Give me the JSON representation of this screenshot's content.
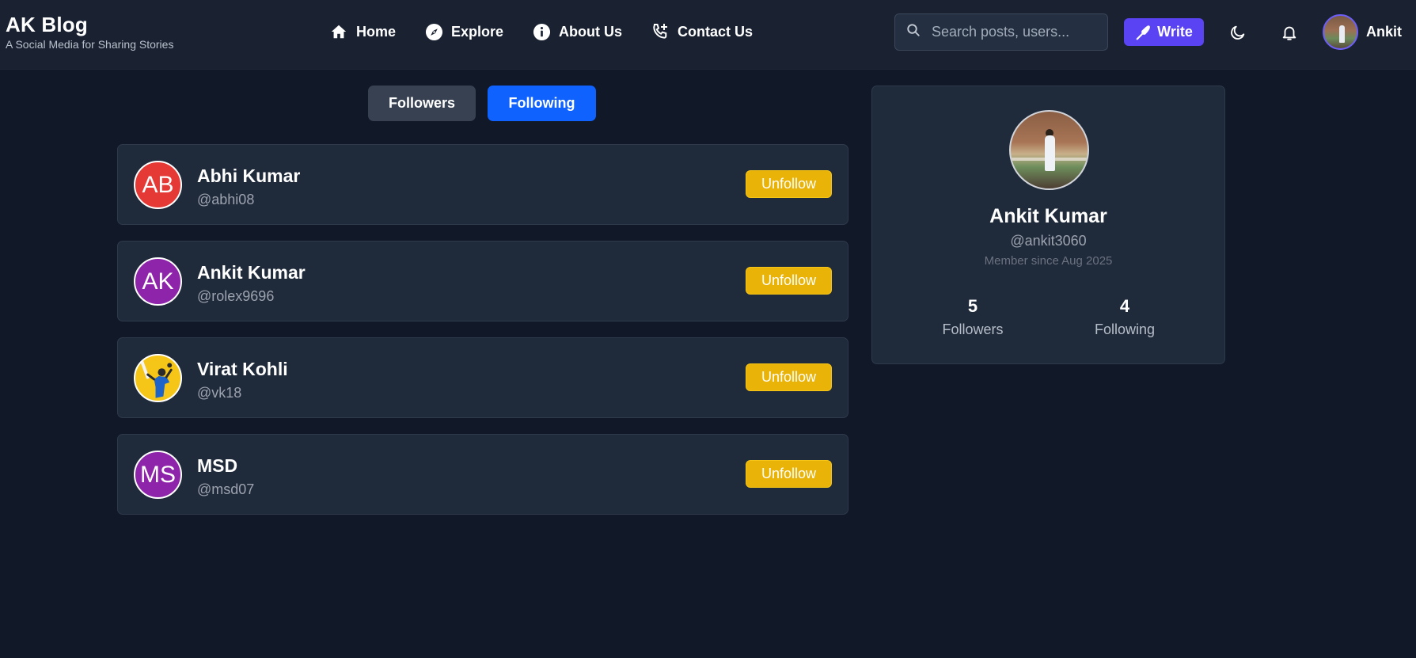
{
  "brand": {
    "title": "AK Blog",
    "subtitle": "A Social Media for Sharing Stories"
  },
  "nav": [
    {
      "label": "Home",
      "icon": "home-icon"
    },
    {
      "label": "Explore",
      "icon": "compass-icon"
    },
    {
      "label": "About Us",
      "icon": "info-icon"
    },
    {
      "label": "Contact Us",
      "icon": "phone-add-icon"
    }
  ],
  "search": {
    "placeholder": "Search posts, users..."
  },
  "write_label": "Write",
  "user": {
    "name": "Ankit"
  },
  "tabs": {
    "followers": "Followers",
    "following": "Following",
    "active": "following"
  },
  "following": [
    {
      "name": "Abhi Kumar",
      "handle": "@abhi08",
      "initials": "AB",
      "avatar_color": "#e53935",
      "button": "Unfollow"
    },
    {
      "name": "Ankit Kumar",
      "handle": "@rolex9696",
      "initials": "AK",
      "avatar_color": "#8e24aa",
      "button": "Unfollow"
    },
    {
      "name": "Virat Kohli",
      "handle": "@vk18",
      "initials": "",
      "avatar_color": "#f5c518",
      "button": "Unfollow"
    },
    {
      "name": "MSD",
      "handle": "@msd07",
      "initials": "MS",
      "avatar_color": "#8e24aa",
      "button": "Unfollow"
    }
  ],
  "profile": {
    "name": "Ankit Kumar",
    "handle": "@ankit3060",
    "member_since": "Member since Aug 2025",
    "followers_count": "5",
    "followers_label": "Followers",
    "following_count": "4",
    "following_label": "Following"
  },
  "colors": {
    "background": "#111827",
    "header": "#1a2232",
    "card": "#1f2a3a",
    "active_tab": "#1062fe",
    "write_button": "#5a43f2",
    "unfollow_button": "#eab308"
  }
}
